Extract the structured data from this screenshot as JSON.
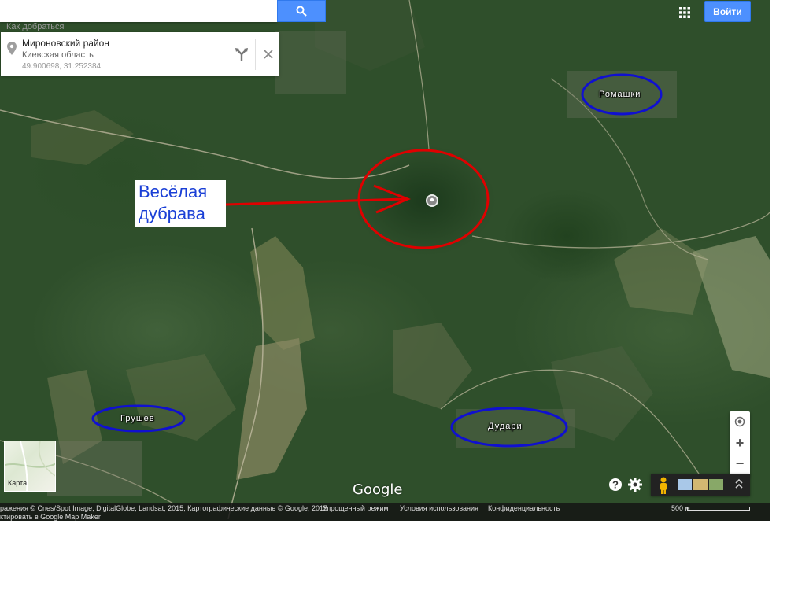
{
  "search": {
    "placeholder": "",
    "button_icon": "search-icon",
    "directions_link": "Как добраться"
  },
  "place_card": {
    "title": "Мироновский район",
    "subtitle": "Киевская область",
    "coordinates": "49.900698, 31.252384",
    "route_icon": "directions-icon",
    "close_icon": "close-icon"
  },
  "header": {
    "apps_icon": "apps-grid-icon",
    "signin_label": "Войти"
  },
  "annotation": {
    "line1": "Весёлая",
    "line2": "дубрава",
    "arrow_color": "#e00000",
    "circle_color": "#e00000"
  },
  "villages": [
    {
      "label": "Ромашки"
    },
    {
      "label": "Грушев"
    },
    {
      "label": "Дудари"
    }
  ],
  "village_circle_color": "#1010d0",
  "layer_switch": {
    "label": "Карта"
  },
  "logo": "Google",
  "controls": {
    "zoom_in": "+",
    "zoom_out": "−",
    "my_location_icon": "my-location-icon",
    "pegman_icon": "pegman-icon",
    "expand_icon": "chevron-up-icon",
    "help_icon": "help-icon",
    "settings_icon": "gear-icon"
  },
  "attribution": {
    "imagery": "ражения © Cnes/Spot Image, DigitalGlobe, Landsat, 2015, Картографические данные © Google, 2015",
    "lite_mode": "Упрощенный режим",
    "terms": "Условия использования",
    "privacy": "Конфиденциальность",
    "map_maker": "ктировать в Google Map Maker",
    "scale": "500 м"
  }
}
